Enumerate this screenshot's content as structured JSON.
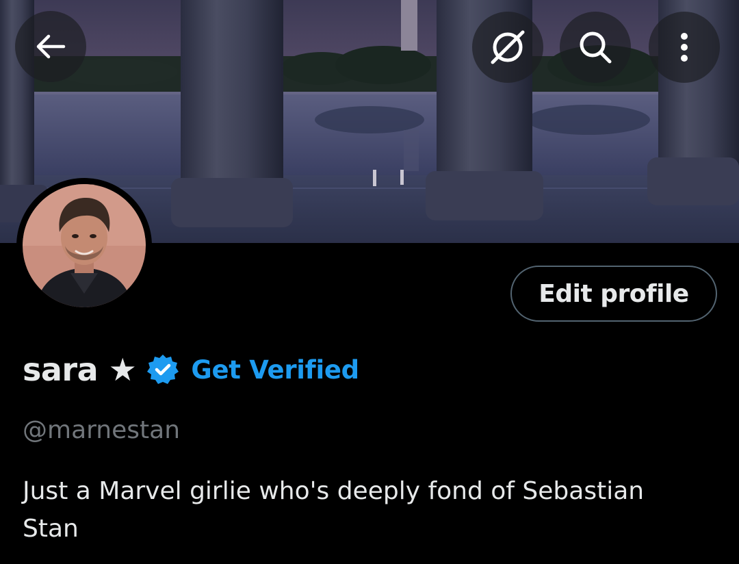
{
  "header": {
    "back_icon": "arrow-left-icon",
    "grok_icon": "grok-icon",
    "search_icon": "search-icon",
    "more_icon": "more-vertical-icon"
  },
  "banner": {
    "description_icon": "banner-image"
  },
  "profile": {
    "display_name": "sara ★",
    "verified_icon": "verified-badge-icon",
    "get_verified_label": "Get Verified",
    "handle": "@marnestan",
    "bio": "Just a Marvel girlie who's deeply fond of Sebastian Stan",
    "edit_profile_label": "Edit profile"
  },
  "colors": {
    "background": "#000000",
    "text_primary": "#e7e9ea",
    "text_secondary": "#71767b",
    "accent": "#1d9bf0",
    "button_border": "#536471"
  }
}
